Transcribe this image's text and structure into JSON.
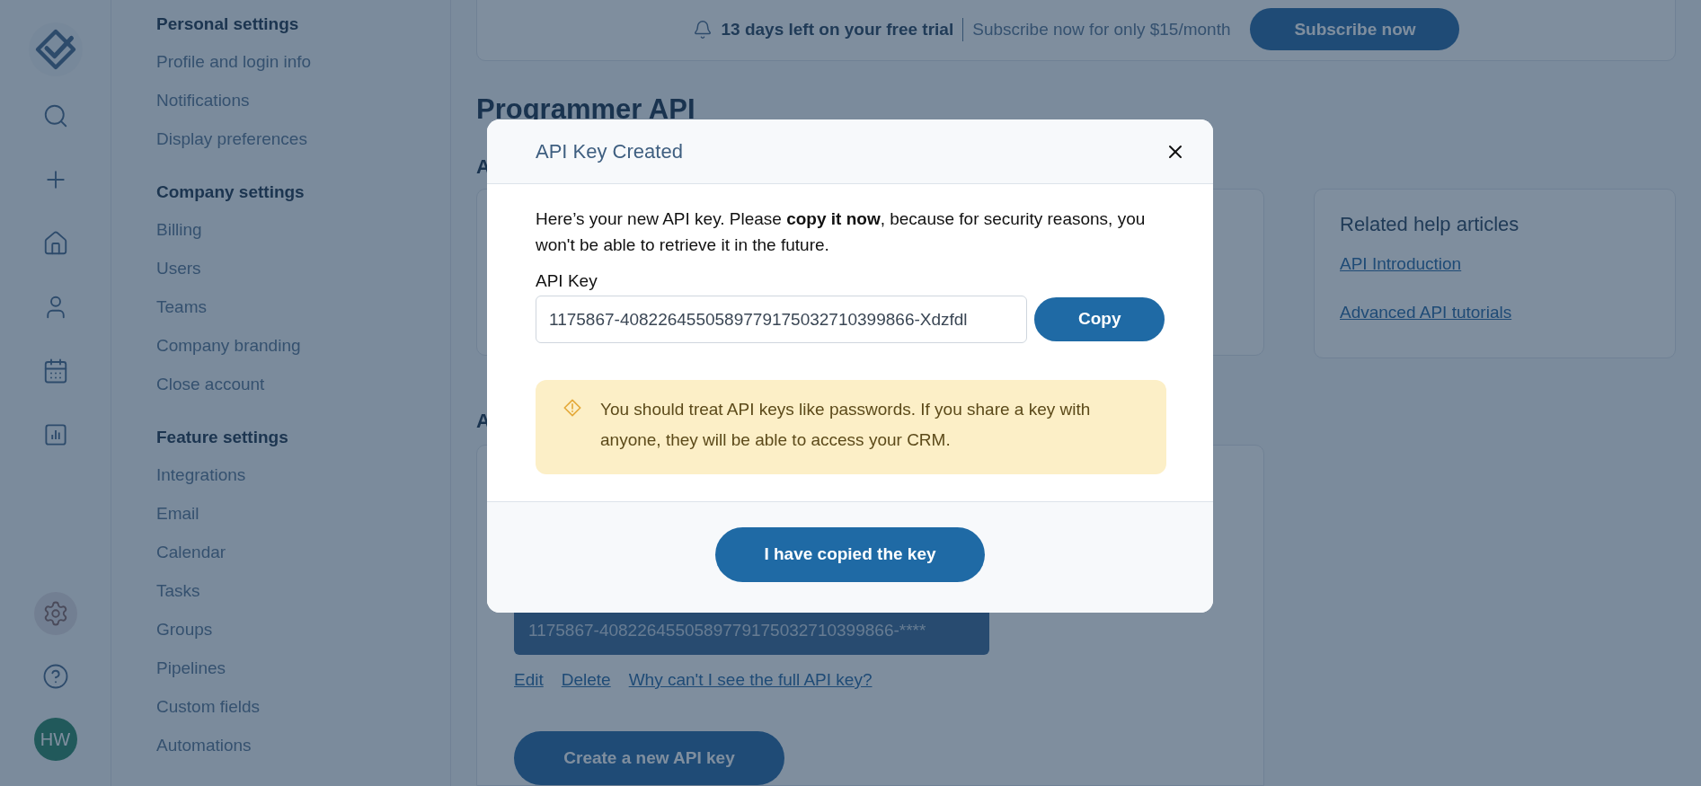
{
  "rail": {
    "items": [
      {
        "kind": "search",
        "selected": false
      },
      {
        "kind": "add",
        "selected": false
      },
      {
        "kind": "home",
        "selected": false
      },
      {
        "kind": "contacts",
        "selected": false
      },
      {
        "kind": "calendar",
        "selected": false
      },
      {
        "kind": "reports",
        "selected": false
      }
    ],
    "bottom": [
      {
        "kind": "settings",
        "selected": true
      },
      {
        "kind": "help",
        "selected": false
      }
    ],
    "avatar": "HW"
  },
  "settings_nav": [
    {
      "heading": "Personal settings",
      "items": [
        "Profile and login info",
        "Notifications",
        "Display preferences"
      ]
    },
    {
      "heading": "Company settings",
      "items": [
        "Billing",
        "Users",
        "Teams",
        "Company branding",
        "Close account"
      ]
    },
    {
      "heading": "Feature settings",
      "items": [
        "Integrations",
        "Email",
        "Calendar",
        "Tasks",
        "Groups",
        "Pipelines",
        "Custom fields",
        "Automations"
      ]
    }
  ],
  "trial_banner": {
    "days_left": "13 days left on your free trial",
    "offer": "Subscribe now for only $15/month",
    "button": "Subscribe now"
  },
  "page_title": "Programmer API",
  "section_headings": [
    "A",
    "A"
  ],
  "help_articles": {
    "title": "Related help articles",
    "links": [
      "API Introduction",
      "Advanced API tutorials"
    ]
  },
  "key_card": {
    "masked_key": "1175867-4082264550589779175032710399866-****",
    "links": [
      "Edit",
      "Delete",
      "Why can't I see the full API key?"
    ],
    "create_button": "Create a new API key"
  },
  "modal": {
    "title": "API Key Created",
    "intro": "Here’s your new API key. Please **copy it now**, because for security reasons, you won't be able to retrieve it in the future.",
    "field_label": "API Key",
    "key_value": "1175867-4082264550589779175032710399866-Xdzfdl",
    "copy_button": "Copy",
    "warning": "You should treat API keys like passwords. If you share a key with anyone, they will be able to access your CRM.",
    "confirm_button": "I have copied the key"
  }
}
